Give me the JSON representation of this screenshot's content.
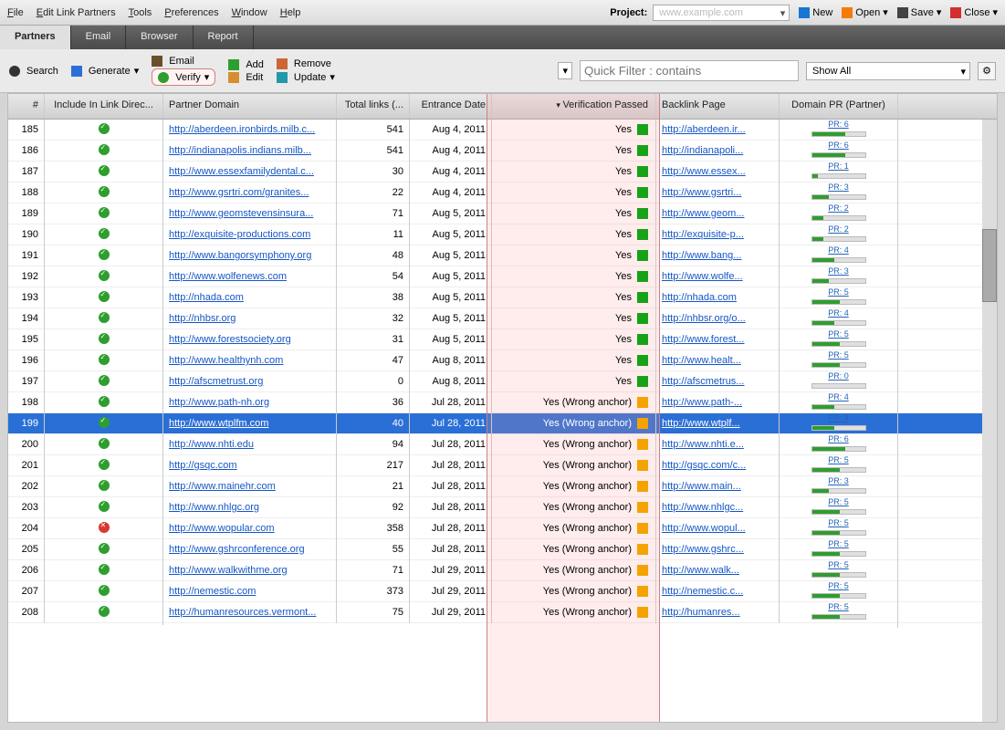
{
  "menu": {
    "file": "File",
    "edit": "Edit Link Partners",
    "tools": "Tools",
    "prefs": "Preferences",
    "window": "Window",
    "help": "Help"
  },
  "project": {
    "label": "Project:",
    "value": "www.example.com",
    "new": "New",
    "open": "Open",
    "save": "Save",
    "close": "Close"
  },
  "tabs": {
    "partners": "Partners",
    "email": "Email",
    "browser": "Browser",
    "report": "Report"
  },
  "toolbar": {
    "search": "Search",
    "generate": "Generate",
    "email": "Email",
    "verify": "Verify",
    "add": "Add",
    "edit": "Edit",
    "remove": "Remove",
    "update": "Update"
  },
  "filter": {
    "placeholder": "Quick Filter : contains",
    "showall": "Show All"
  },
  "columns": {
    "num": "#",
    "inc": "Include In Link Direc...",
    "dom": "Partner Domain",
    "tot": "Total links (...",
    "dat": "Entrance Date",
    "ver": "Verification Passed",
    "bak": "Backlink Page",
    "pr": "Domain PR (Partner)"
  },
  "rows": [
    {
      "n": 185,
      "ok": true,
      "dom": "http://aberdeen.ironbirds.milb.c...",
      "tot": 541,
      "dat": "Aug 4, 2011",
      "ver": "Yes",
      "vc": "green",
      "bak": "http://aberdeen.ir...",
      "pr": 6
    },
    {
      "n": 186,
      "ok": true,
      "dom": "http://indianapolis.indians.milb...",
      "tot": 541,
      "dat": "Aug 4, 2011",
      "ver": "Yes",
      "vc": "green",
      "bak": "http://indianapoli...",
      "pr": 6
    },
    {
      "n": 187,
      "ok": true,
      "dom": "http://www.essexfamilydental.c...",
      "tot": 30,
      "dat": "Aug 4, 2011",
      "ver": "Yes",
      "vc": "green",
      "bak": "http://www.essex...",
      "pr": 1
    },
    {
      "n": 188,
      "ok": true,
      "dom": "http://www.gsrtri.com/granites...",
      "tot": 22,
      "dat": "Aug 4, 2011",
      "ver": "Yes",
      "vc": "green",
      "bak": "http://www.gsrtri...",
      "pr": 3
    },
    {
      "n": 189,
      "ok": true,
      "dom": "http://www.geomstevensinsura...",
      "tot": 71,
      "dat": "Aug 5, 2011",
      "ver": "Yes",
      "vc": "green",
      "bak": "http://www.geom...",
      "pr": 2
    },
    {
      "n": 190,
      "ok": true,
      "dom": "http://exquisite-productions.com",
      "tot": 11,
      "dat": "Aug 5, 2011",
      "ver": "Yes",
      "vc": "green",
      "bak": "http://exquisite-p...",
      "pr": 2
    },
    {
      "n": 191,
      "ok": true,
      "dom": "http://www.bangorsymphony.org",
      "tot": 48,
      "dat": "Aug 5, 2011",
      "ver": "Yes",
      "vc": "green",
      "bak": "http://www.bang...",
      "pr": 4
    },
    {
      "n": 192,
      "ok": true,
      "dom": "http://www.wolfenews.com",
      "tot": 54,
      "dat": "Aug 5, 2011",
      "ver": "Yes",
      "vc": "green",
      "bak": "http://www.wolfe...",
      "pr": 3
    },
    {
      "n": 193,
      "ok": true,
      "dom": "http://nhada.com",
      "tot": 38,
      "dat": "Aug 5, 2011",
      "ver": "Yes",
      "vc": "green",
      "bak": "http://nhada.com",
      "pr": 5
    },
    {
      "n": 194,
      "ok": true,
      "dom": "http://nhbsr.org",
      "tot": 32,
      "dat": "Aug 5, 2011",
      "ver": "Yes",
      "vc": "green",
      "bak": "http://nhbsr.org/o...",
      "pr": 4
    },
    {
      "n": 195,
      "ok": true,
      "dom": "http://www.forestsociety.org",
      "tot": 31,
      "dat": "Aug 5, 2011",
      "ver": "Yes",
      "vc": "green",
      "bak": "http://www.forest...",
      "pr": 5
    },
    {
      "n": 196,
      "ok": true,
      "dom": "http://www.healthynh.com",
      "tot": 47,
      "dat": "Aug 8, 2011",
      "ver": "Yes",
      "vc": "green",
      "bak": "http://www.healt...",
      "pr": 5
    },
    {
      "n": 197,
      "ok": true,
      "dom": "http://afscmetrust.org",
      "tot": 0,
      "dat": "Aug 8, 2011",
      "ver": "Yes",
      "vc": "green",
      "bak": "http://afscmetrus...",
      "pr": 0
    },
    {
      "n": 198,
      "ok": true,
      "dom": "http://www.path-nh.org",
      "tot": 36,
      "dat": "Jul 28, 2011",
      "ver": "Yes (Wrong anchor)",
      "vc": "orange",
      "bak": "http://www.path-...",
      "pr": 4
    },
    {
      "n": 199,
      "ok": true,
      "sel": true,
      "dom": "http://www.wtplfm.com",
      "tot": 40,
      "dat": "Jul 28, 2011",
      "ver": "Yes (Wrong anchor)",
      "vc": "orange",
      "bak": "http://www.wtplf...",
      "pr": 4
    },
    {
      "n": 200,
      "ok": true,
      "dom": "http://www.nhti.edu",
      "tot": 94,
      "dat": "Jul 28, 2011",
      "ver": "Yes (Wrong anchor)",
      "vc": "orange",
      "bak": "http://www.nhti.e...",
      "pr": 6
    },
    {
      "n": 201,
      "ok": true,
      "dom": "http://gsqc.com",
      "tot": 217,
      "dat": "Jul 28, 2011",
      "ver": "Yes (Wrong anchor)",
      "vc": "orange",
      "bak": "http://gsqc.com/c...",
      "pr": 5
    },
    {
      "n": 202,
      "ok": true,
      "dom": "http://www.mainehr.com",
      "tot": 21,
      "dat": "Jul 28, 2011",
      "ver": "Yes (Wrong anchor)",
      "vc": "orange",
      "bak": "http://www.main...",
      "pr": 3
    },
    {
      "n": 203,
      "ok": true,
      "dom": "http://www.nhlgc.org",
      "tot": 92,
      "dat": "Jul 28, 2011",
      "ver": "Yes (Wrong anchor)",
      "vc": "orange",
      "bak": "http://www.nhlgc...",
      "pr": 5
    },
    {
      "n": 204,
      "ok": false,
      "dom": "http://www.wopular.com",
      "tot": 358,
      "dat": "Jul 28, 2011",
      "ver": "Yes (Wrong anchor)",
      "vc": "orange",
      "bak": "http://www.wopul...",
      "pr": 5
    },
    {
      "n": 205,
      "ok": true,
      "dom": "http://www.gshrconference.org",
      "tot": 55,
      "dat": "Jul 28, 2011",
      "ver": "Yes (Wrong anchor)",
      "vc": "orange",
      "bak": "http://www.gshrc...",
      "pr": 5
    },
    {
      "n": 206,
      "ok": true,
      "dom": "http://www.walkwithme.org",
      "tot": 71,
      "dat": "Jul 29, 2011",
      "ver": "Yes (Wrong anchor)",
      "vc": "orange",
      "bak": "http://www.walk...",
      "pr": 5
    },
    {
      "n": 207,
      "ok": true,
      "dom": "http://nemestic.com",
      "tot": 373,
      "dat": "Jul 29, 2011",
      "ver": "Yes (Wrong anchor)",
      "vc": "orange",
      "bak": "http://nemestic.c...",
      "pr": 5
    },
    {
      "n": 208,
      "ok": true,
      "dom": "http://humanresources.vermont...",
      "tot": 75,
      "dat": "Jul 29, 2011",
      "ver": "Yes (Wrong anchor)",
      "vc": "orange",
      "bak": "http://humanres...",
      "pr": 5
    }
  ]
}
